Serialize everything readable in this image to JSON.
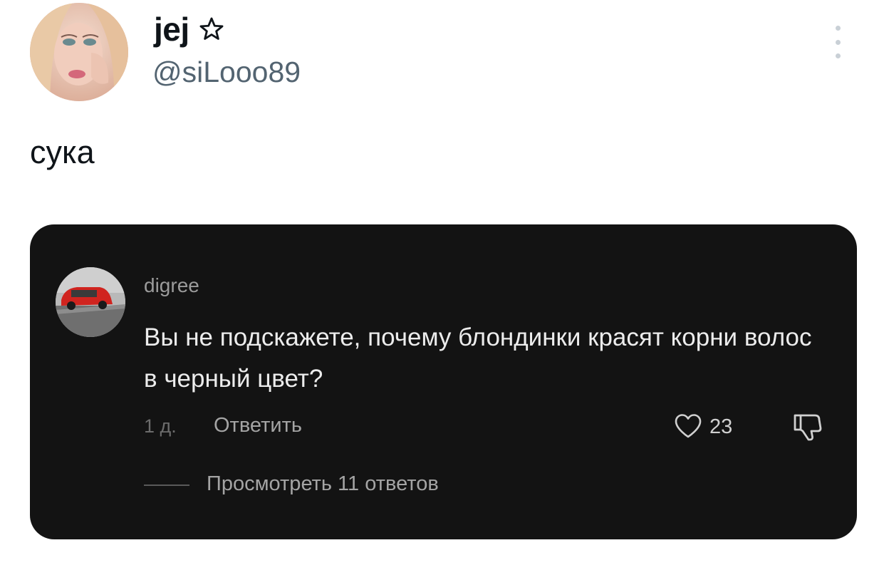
{
  "post": {
    "display_name": "jej",
    "handle": "@siLooo89",
    "text": "сука",
    "badge_icon": "star-outline-icon",
    "menu_icon": "more-vertical-icon"
  },
  "comment": {
    "username": "digree",
    "text": "Вы не подскажете, почему блондинки красят корни волос в черный цвет?",
    "time": "1 д.",
    "reply_label": "Ответить",
    "likes": "23",
    "view_replies_label": "Просмотреть 11 ответов",
    "like_icon": "heart-icon",
    "dislike_icon": "thumbs-down-icon"
  },
  "colors": {
    "card_bg": "#131313",
    "handle": "#536471"
  }
}
